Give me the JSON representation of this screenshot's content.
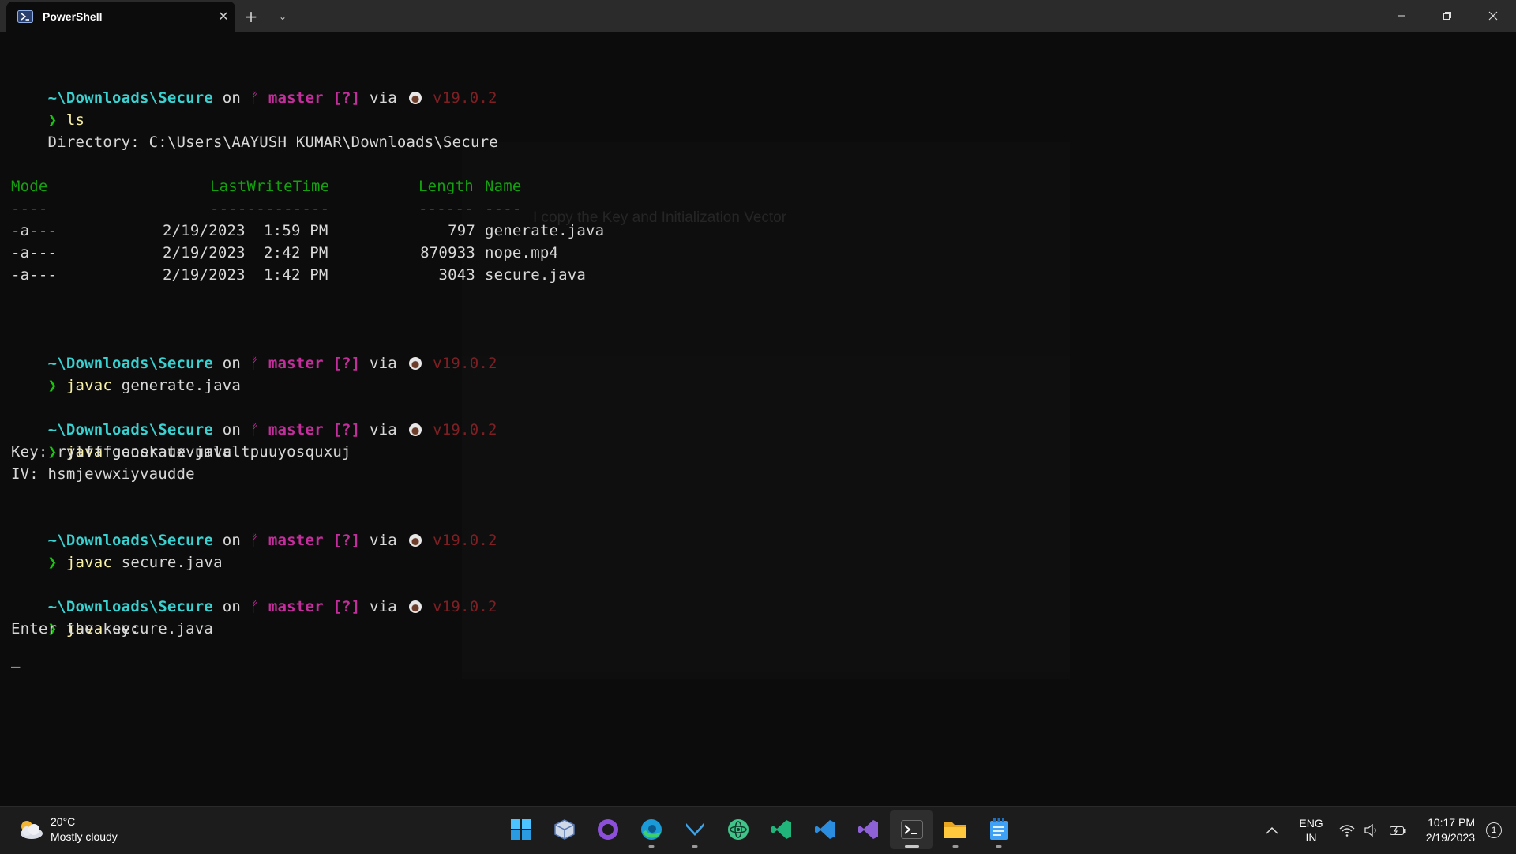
{
  "window": {
    "tab_title": "PowerShell",
    "new_tab_symbol": "+",
    "colors": {
      "terminal_bg": "#0c0c0c",
      "titlebar_bg": "#2b2b2b",
      "path": "#3ad1d1",
      "branch": "#c42e9c",
      "version": "#7e1f24",
      "prompt_arrow": "#16c60c",
      "command": "#f9f1a5",
      "table_header": "#13a10e"
    }
  },
  "prompt": {
    "path": "~\\Downloads\\Secure",
    "on": "on",
    "branch_glyph": "ᚠ",
    "branch": "master",
    "status": "[?]",
    "via": "via",
    "version": "v19.0.2",
    "arrow": "❯"
  },
  "commands": {
    "c1": "ls",
    "c2_bin": "javac",
    "c2_arg": "generate.java",
    "c3_bin": "java",
    "c3_arg": "generate.java",
    "c4_bin": "javac",
    "c4_arg": "secure.java",
    "c5_bin": "java",
    "c5_arg": "secure.java"
  },
  "ls_output": {
    "directory": "    Directory: C:\\Users\\AAYUSH KUMAR\\Downloads\\Secure",
    "header": {
      "mode": "Mode",
      "lwt": "LastWriteTime",
      "length": "Length",
      "name": "Name"
    },
    "underline": {
      "mode": "----",
      "lwt": "-------------",
      "length": "------",
      "name": "----"
    },
    "rows": [
      {
        "mode": "-a---",
        "date": "2/19/2023",
        "time": " 1:59 PM",
        "length": "797",
        "name": "generate.java"
      },
      {
        "mode": "-a---",
        "date": "2/19/2023",
        "time": " 2:42 PM",
        "length": "870933",
        "name": "nope.mp4"
      },
      {
        "mode": "-a---",
        "date": "2/19/2023",
        "time": " 1:42 PM",
        "length": "3043",
        "name": "secure.java"
      }
    ]
  },
  "program_output": {
    "key_line": "Key: rylfffgooskauxvumlcltpuuyosquxuj",
    "iv_line": "IV: hsmjevwxiyvaudde",
    "enter_key": "Enter the key:",
    "cursor": "_"
  },
  "ghost_text": "I copy the Key and Initialization Vector",
  "taskbar": {
    "weather": {
      "temp": "20°C",
      "condition": "Mostly cloudy"
    },
    "apps": [
      "start-icon",
      "virtualbox-icon",
      "github-desktop-icon",
      "edge-icon",
      "cursor-app-icon",
      "atom-icon",
      "vscode-insiders-icon",
      "vscode-icon",
      "visual-studio-icon",
      "terminal-icon",
      "file-explorer-icon",
      "notepad-icon"
    ],
    "lang": {
      "line1": "ENG",
      "line2": "IN"
    },
    "clock": {
      "time": "10:17 PM",
      "date": "2/19/2023"
    },
    "notification_count": "1"
  }
}
